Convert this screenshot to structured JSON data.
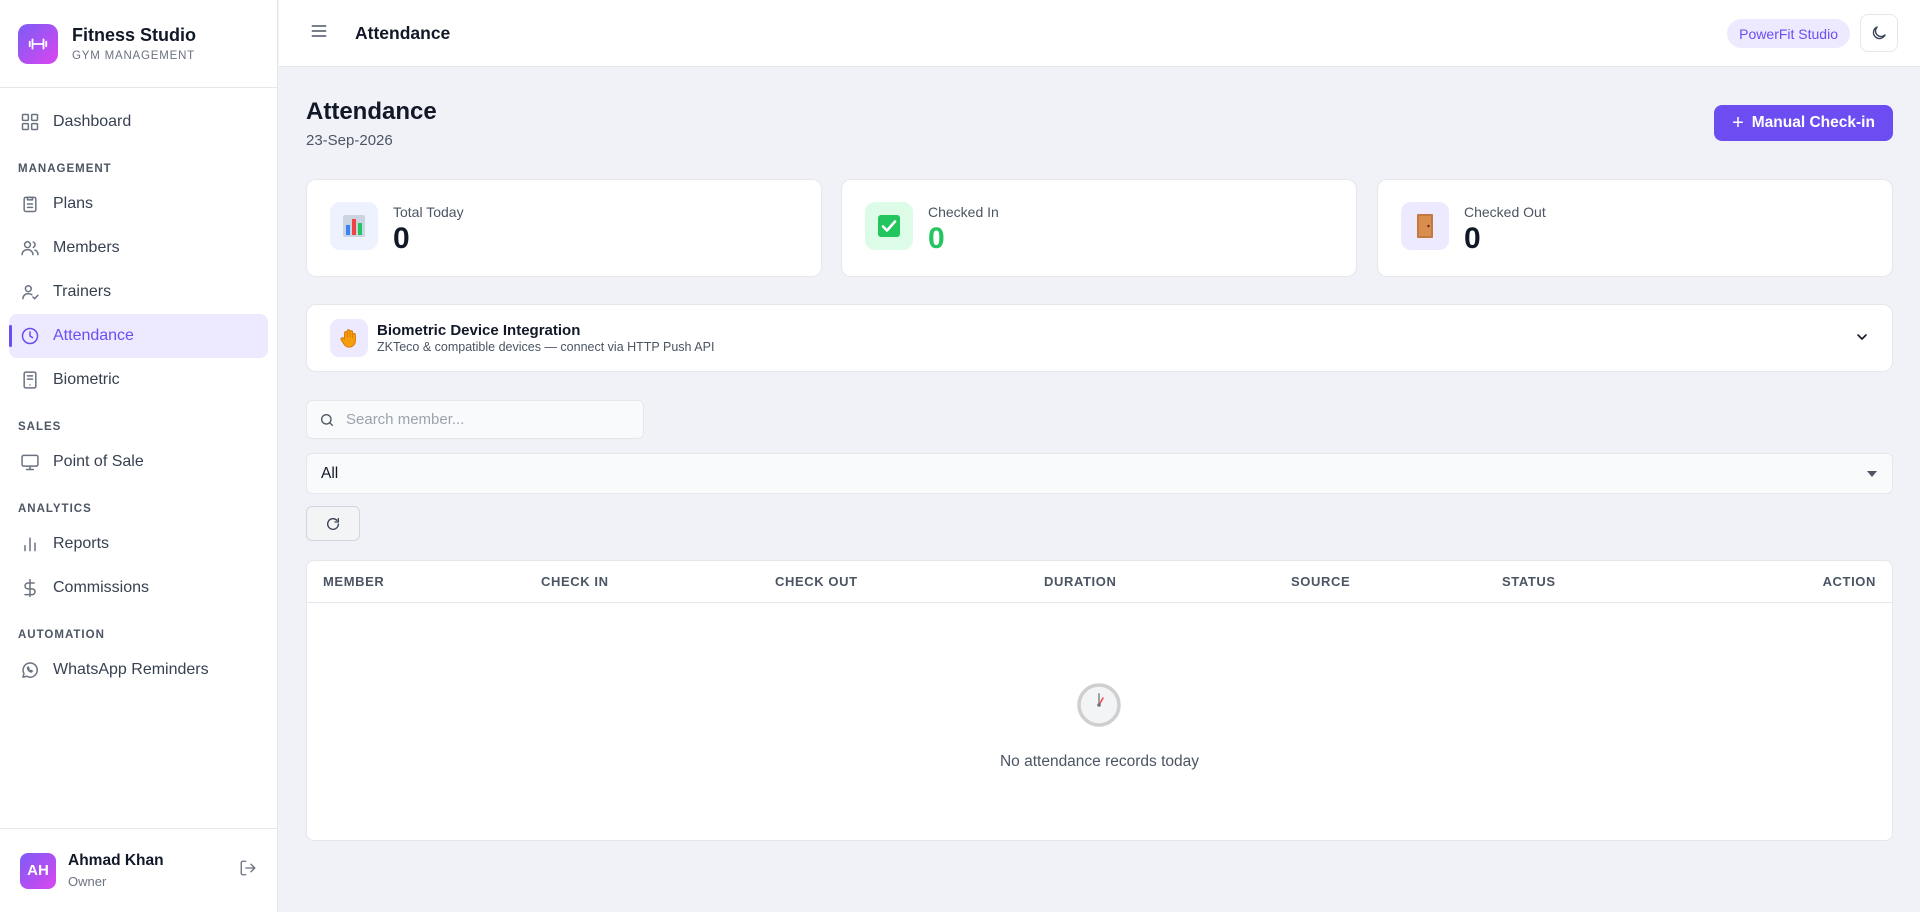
{
  "brand": {
    "name": "Fitness Studio",
    "subtitle": "GYM MANAGEMENT",
    "logo_icon": "dumbbell-icon"
  },
  "sidebar": {
    "dashboard": {
      "label": "Dashboard",
      "icon": "grid-icon"
    },
    "sections": {
      "management": "MANAGEMENT",
      "sales": "SALES",
      "analytics": "ANALYTICS",
      "automation": "AUTOMATION"
    },
    "items": {
      "plans": {
        "label": "Plans",
        "icon": "clipboard-icon"
      },
      "members": {
        "label": "Members",
        "icon": "users-icon"
      },
      "trainers": {
        "label": "Trainers",
        "icon": "user-check-icon"
      },
      "attendance": {
        "label": "Attendance",
        "icon": "clock-icon",
        "active": true
      },
      "biometric": {
        "label": "Biometric",
        "icon": "tablet-icon"
      },
      "pos": {
        "label": "Point of Sale",
        "icon": "monitor-icon"
      },
      "reports": {
        "label": "Reports",
        "icon": "bar-chart-icon"
      },
      "commissions": {
        "label": "Commissions",
        "icon": "dollar-icon"
      },
      "whatsapp": {
        "label": "WhatsApp Reminders",
        "icon": "whatsapp-icon"
      }
    }
  },
  "user": {
    "initials": "AH",
    "name": "Ahmad Khan",
    "role": "Owner"
  },
  "header": {
    "title": "Attendance",
    "studio": "PowerFit Studio",
    "theme_icon": "moon-icon"
  },
  "page": {
    "title": "Attendance",
    "date": "23-Sep-2026",
    "checkin_label": "Manual Check-in"
  },
  "stats": [
    {
      "label": "Total Today",
      "value": "0",
      "icon": "bar-chart-emoji",
      "value_color": "#111827"
    },
    {
      "label": "Checked In",
      "value": "0",
      "icon": "check-mark-emoji",
      "value_color": "#22c55e"
    },
    {
      "label": "Checked Out",
      "value": "0",
      "icon": "door-emoji",
      "value_color": "#111827"
    }
  ],
  "biometric": {
    "title": "Biometric Device Integration",
    "subtitle": "ZKTeco & compatible devices — connect via HTTP Push API",
    "icon": "raised-hand-emoji"
  },
  "search": {
    "placeholder": "Search member..."
  },
  "filter": {
    "selected": "All"
  },
  "table": {
    "columns": [
      "MEMBER",
      "CHECK IN",
      "CHECK OUT",
      "DURATION",
      "SOURCE",
      "STATUS",
      "ACTION"
    ],
    "rows": [],
    "empty_text": "No attendance records today"
  },
  "colors": {
    "accent": "#6d4df2",
    "accent_light": "#ede9fe",
    "success": "#22c55e",
    "background": "#f1f2f7"
  }
}
